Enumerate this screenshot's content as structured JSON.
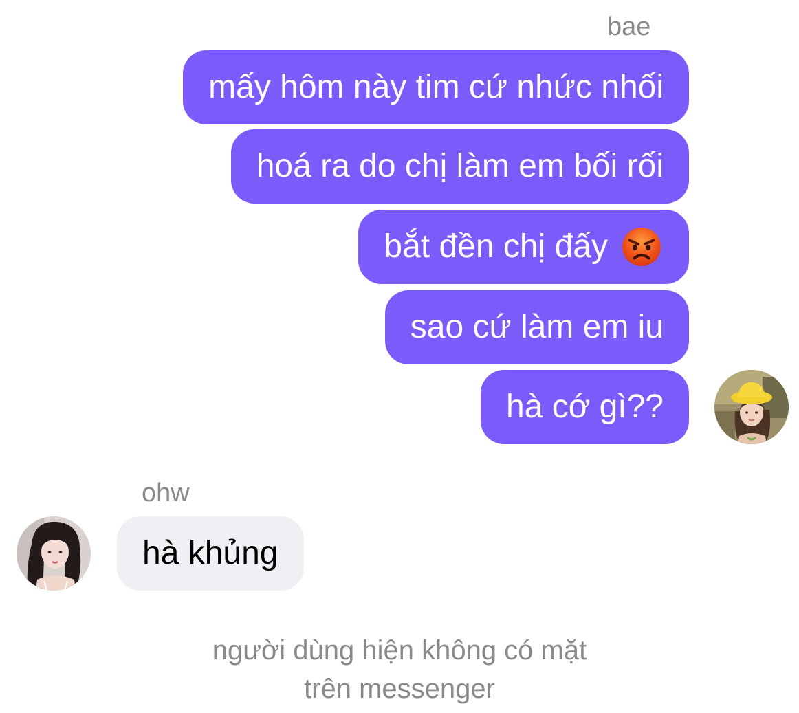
{
  "conversation": {
    "outgoing_sender": "bae",
    "outgoing_messages": [
      "mấy hôm này tim cứ nhức nhối",
      "hoá ra do chị làm em bối rối",
      "bắt đền chị đấy",
      "sao cứ làm em iu",
      "hà cớ gì??"
    ],
    "outgoing_emoji": "angry-face-emoji",
    "incoming_sender": "ohw",
    "incoming_messages": [
      "hà khủng"
    ],
    "status_lines": [
      "người dùng hiện không có mặt",
      "trên messenger"
    ]
  },
  "colors": {
    "outgoing_bubble": "#7b5cfa",
    "incoming_bubble": "#efeff4",
    "meta_text": "#8a8a8e"
  }
}
